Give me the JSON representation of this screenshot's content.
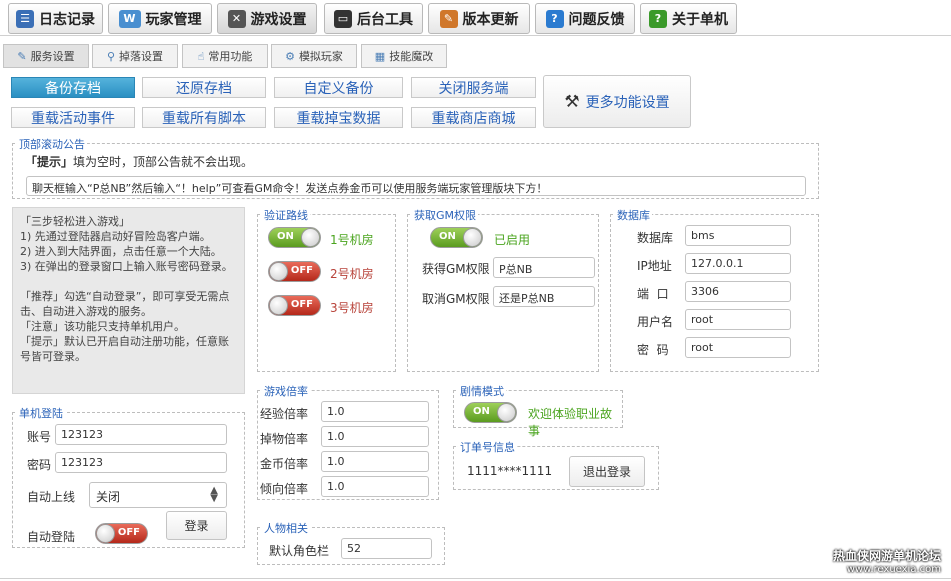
{
  "top_tabs": [
    {
      "label": "日志记录",
      "icon": "log-icon",
      "color": "#3b6fb6"
    },
    {
      "label": "玩家管理",
      "icon": "player-card-icon",
      "color": "#4a8fd0"
    },
    {
      "label": "游戏设置",
      "icon": "wrench-icon",
      "color": "#555555",
      "active": true
    },
    {
      "label": "后台工具",
      "icon": "computer-icon",
      "color": "#333333"
    },
    {
      "label": "版本更新",
      "icon": "update-icon",
      "color": "#d0772a"
    },
    {
      "label": "问题反馈",
      "icon": "feedback-icon",
      "color": "#2b7bd0"
    },
    {
      "label": "关于单机",
      "icon": "help-icon",
      "color": "#3b9a2a"
    }
  ],
  "sub_tabs": [
    {
      "label": "服务设置",
      "icon": "service-icon",
      "active": true
    },
    {
      "label": "掉落设置",
      "icon": "search-icon"
    },
    {
      "label": "常用功能",
      "icon": "hand-icon"
    },
    {
      "label": "模拟玩家",
      "icon": "gear-icon"
    },
    {
      "label": "技能魔改",
      "icon": "skill-icon"
    }
  ],
  "actions": {
    "backup": "备份存档",
    "restore": "还原存档",
    "custom_backup": "自定义备份",
    "close_server": "关闭服务端",
    "reload_events": "重载活动事件",
    "reload_scripts": "重载所有脚本",
    "reload_drops": "重载掉宝数据",
    "reload_shop": "重载商店商城",
    "more": "更多功能设置"
  },
  "announcement": {
    "legend": "顶部滚动公告",
    "hint_tag": "「提示」",
    "hint": "填为空时，顶部公告就不会出现。",
    "value": "聊天框输入“P总NB”然后输入“！help”可查看GM命令！发送点券金币可以使用服务端玩家管理版块下方！"
  },
  "guide": {
    "title": "「三步轻松进入游戏」",
    "lines": [
      "1) 先通过登陆器启动好冒险岛客户端。",
      "2) 进入到大陆界面，点击任意一个大陆。",
      "3) 在弹出的登录窗口上输入账号密码登录。",
      "「推荐」勾选“自动登录”，即可享受无需点击、自动进入游戏的服务。",
      "「注意」该功能只支持单机用户。",
      "「提示」默认已开启自动注册功能，任意账号皆可登录。"
    ]
  },
  "route": {
    "legend": "验证路线",
    "items": [
      {
        "state": "ON",
        "label": "1号机房",
        "on": true
      },
      {
        "state": "OFF",
        "label": "2号机房",
        "on": false
      },
      {
        "state": "OFF",
        "label": "3号机房",
        "on": false
      }
    ]
  },
  "gm": {
    "legend": "获取GM权限",
    "state": "ON",
    "status": "已启用",
    "get_label": "获得GM权限",
    "get_value": "P总NB",
    "cancel_label": "取消GM权限",
    "cancel_value": "还是P总NB"
  },
  "database": {
    "legend": "数据库",
    "fields": [
      {
        "label": "数据库",
        "value": "bms"
      },
      {
        "label": "IP地址",
        "value": "127.0.0.1"
      },
      {
        "label": "端  口",
        "value": "3306"
      },
      {
        "label": "用户名",
        "value": "root"
      },
      {
        "label": "密  码",
        "value": "root"
      }
    ]
  },
  "login": {
    "legend": "单机登陆",
    "account_label": "账号",
    "account_value": "123123",
    "password_label": "密码",
    "password_value": "123123",
    "auto_online_label": "自动上线",
    "auto_online_value": "关闭",
    "auto_login_label": "自动登陆",
    "auto_login_state": "OFF",
    "login_button": "登录"
  },
  "rates": {
    "legend": "游戏倍率",
    "items": [
      {
        "label": "经验倍率",
        "value": "1.0"
      },
      {
        "label": "掉物倍率",
        "value": "1.0"
      },
      {
        "label": "金币倍率",
        "value": "1.0"
      },
      {
        "label": "倾向倍率",
        "value": "1.0"
      }
    ]
  },
  "character": {
    "legend": "人物相关",
    "slots_label": "默认角色栏",
    "slots_value": "52"
  },
  "story": {
    "legend": "剧情模式",
    "state": "ON",
    "status": "欢迎体验职业故事"
  },
  "order": {
    "legend": "订单号信息",
    "value": "1111****1111",
    "logout": "退出登录"
  },
  "watermark": {
    "line1": "热血侠网游单机论坛",
    "line2": "www.rexuexia.com"
  }
}
